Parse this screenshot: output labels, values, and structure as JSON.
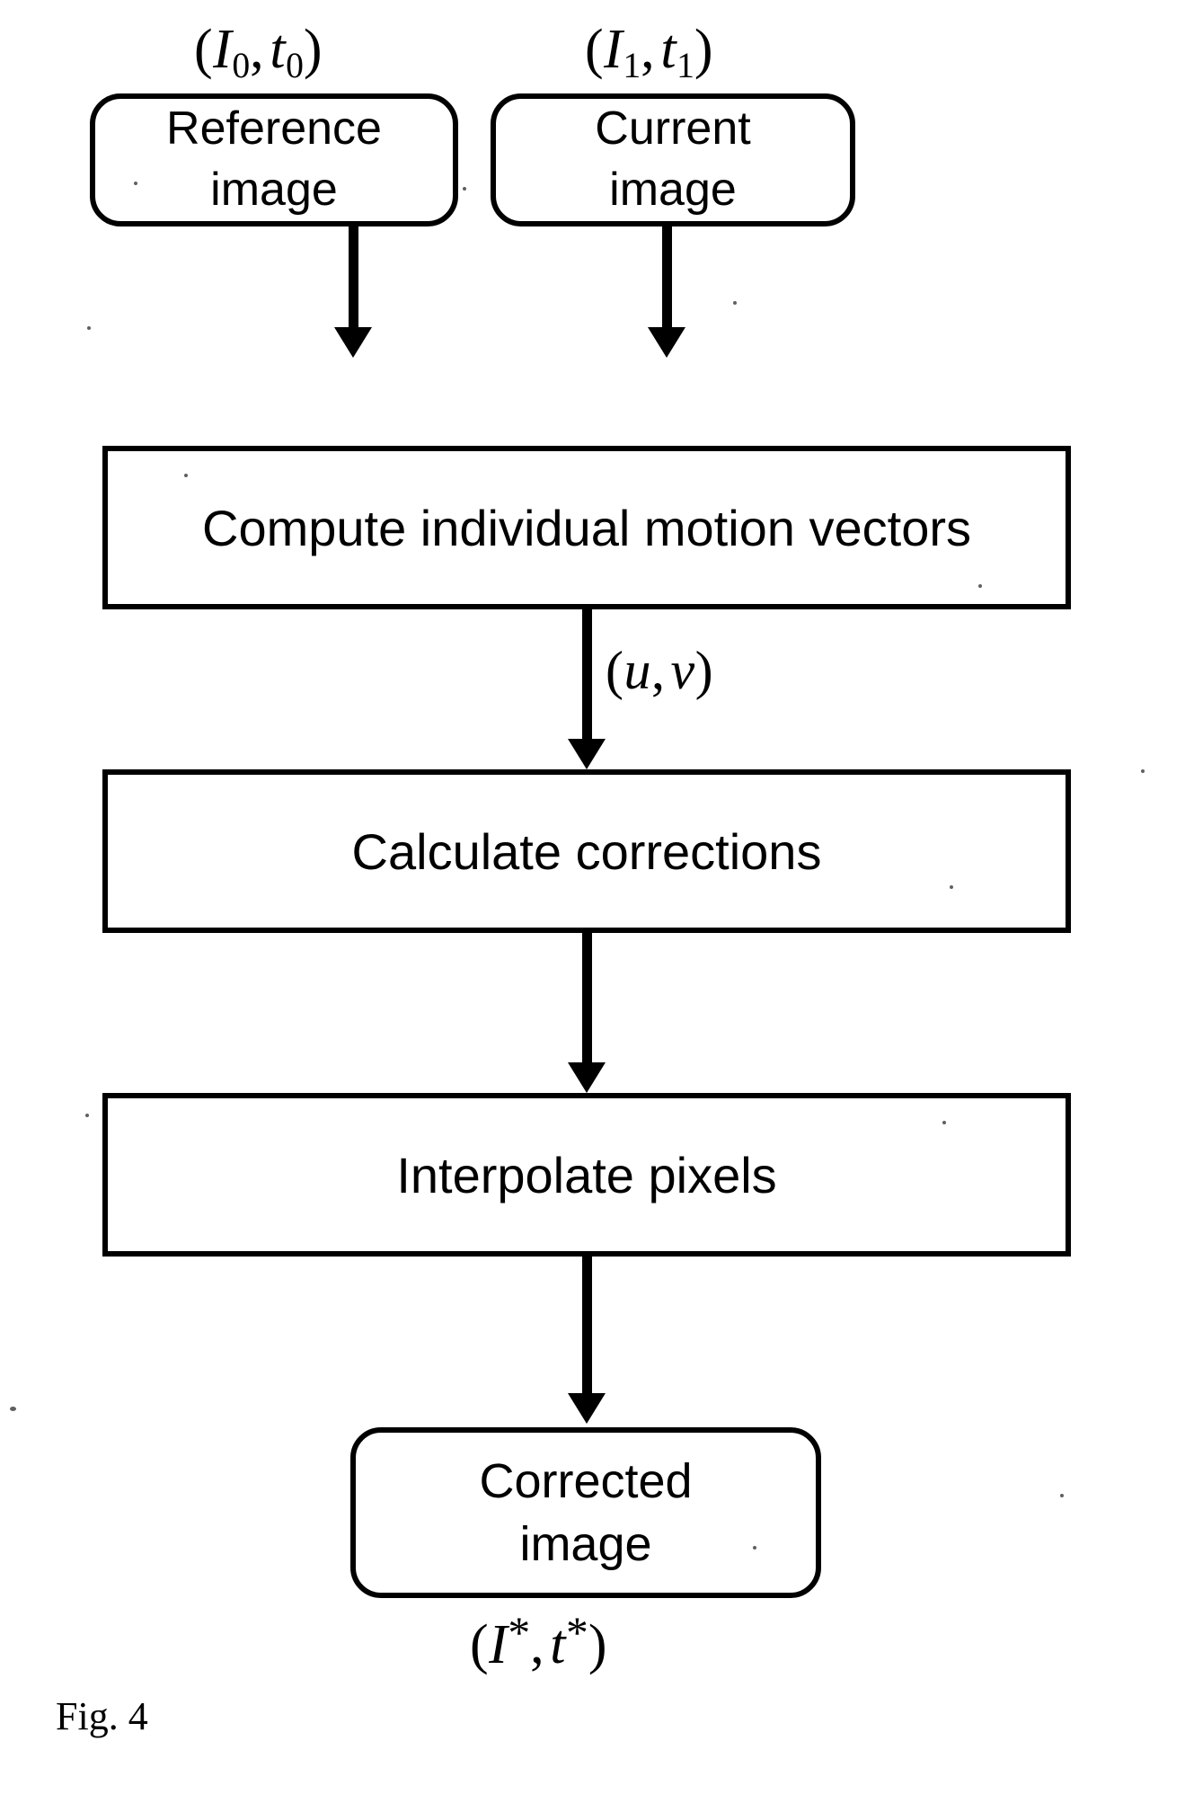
{
  "figure": {
    "caption": "Fig. 4",
    "background_color": "#ffffff",
    "line_color": "#000000"
  },
  "labels": {
    "reference_io": {
      "open": "(",
      "var1": "I",
      "sub1": "0",
      "comma": ",",
      "var2": "t",
      "sub2": "0",
      "close": ")",
      "plain": "(I0, t0)"
    },
    "current_io": {
      "open": "(",
      "var1": "I",
      "sub1": "1",
      "comma": ",",
      "var2": "t",
      "sub2": "1",
      "close": ")",
      "plain": "(I1, t1)"
    },
    "motion_vectors": {
      "open": "(",
      "var1": "u",
      "comma": ",",
      "var2": "v",
      "close": ")",
      "plain": "(u, v)"
    },
    "corrected_io": {
      "open": "(",
      "var1": "I",
      "star1": "*",
      "comma": ",",
      "var2": "t",
      "star2": "*",
      "close": ")",
      "plain": "(I*, t*)"
    }
  },
  "nodes": {
    "reference_image": {
      "line1": "Reference",
      "line2": "image",
      "shape": "rounded"
    },
    "current_image": {
      "line1": "Current",
      "line2": "image",
      "shape": "rounded"
    },
    "compute_motion_vectors": {
      "label": "Compute individual motion vectors",
      "shape": "rectangle"
    },
    "calculate_corrections": {
      "label": "Calculate corrections",
      "shape": "rectangle"
    },
    "interpolate_pixels": {
      "label": "Interpolate pixels",
      "shape": "rectangle"
    },
    "corrected_image": {
      "line1": "Corrected",
      "line2": "image",
      "shape": "rounded"
    }
  },
  "flow": {
    "edges": [
      {
        "from": "reference_image",
        "to": "compute_motion_vectors",
        "label": ""
      },
      {
        "from": "current_image",
        "to": "compute_motion_vectors",
        "label": ""
      },
      {
        "from": "compute_motion_vectors",
        "to": "calculate_corrections",
        "label": "(u, v)"
      },
      {
        "from": "calculate_corrections",
        "to": "interpolate_pixels",
        "label": ""
      },
      {
        "from": "interpolate_pixels",
        "to": "corrected_image",
        "label": ""
      }
    ]
  }
}
